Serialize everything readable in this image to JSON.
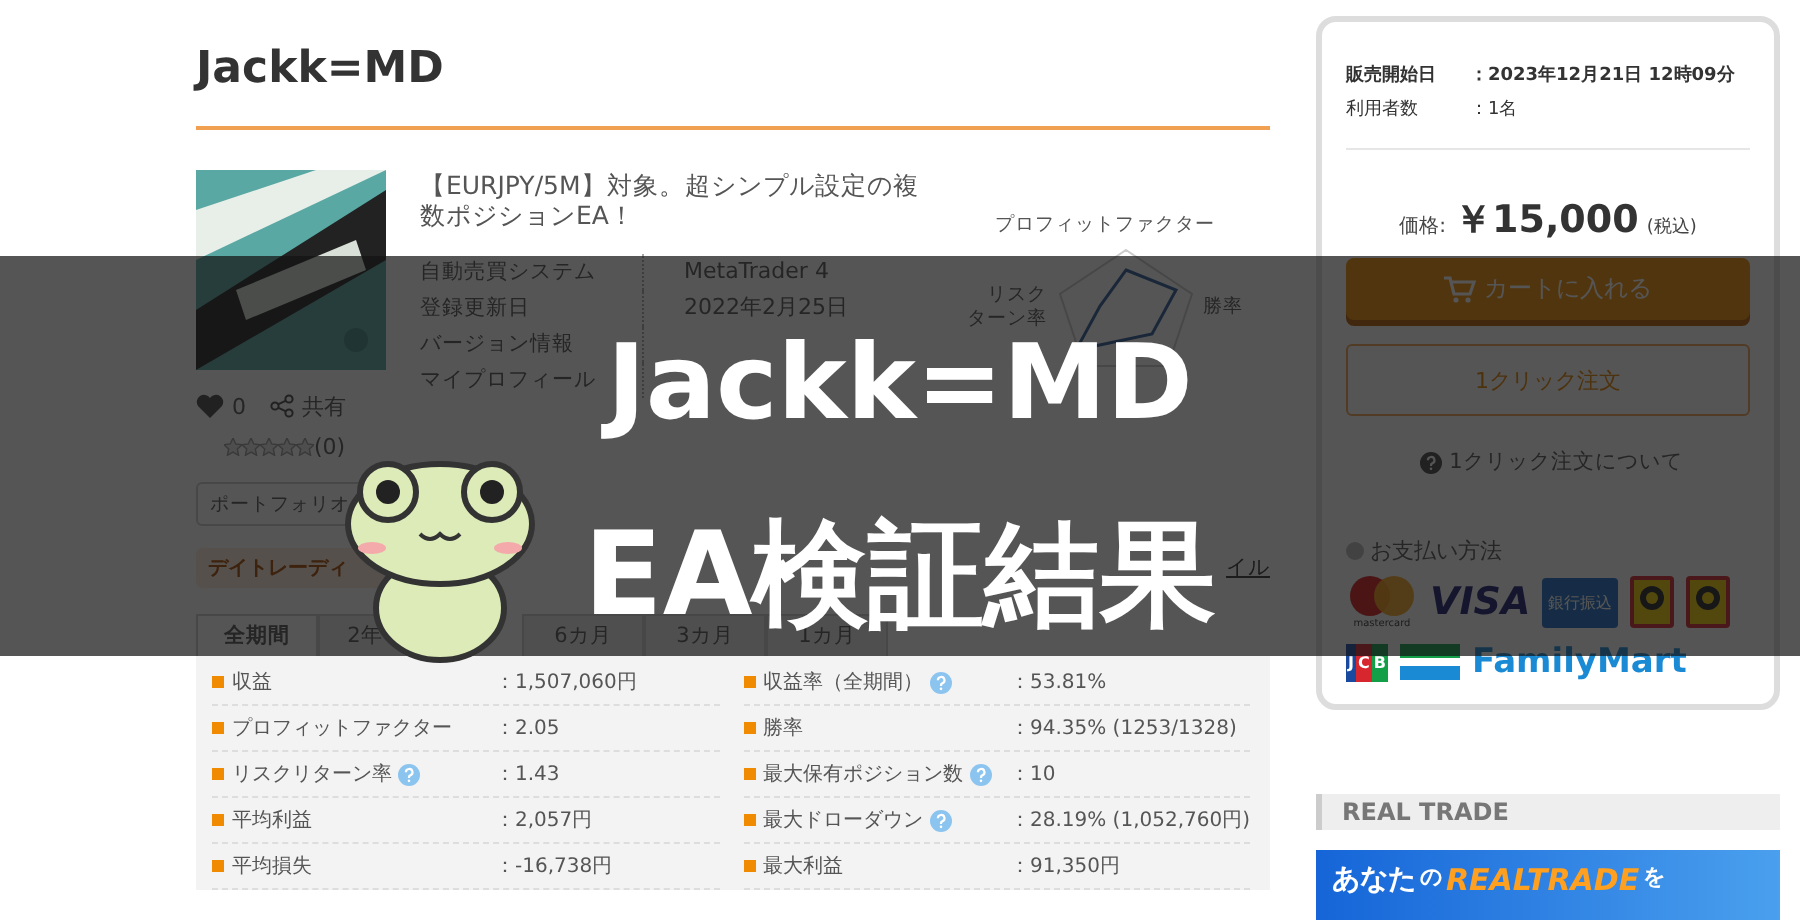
{
  "page_title": "Jackk=MD",
  "product": {
    "description": "【EURJPY/5M】対象。超シンプル設定の複数ポジションEA！",
    "info": [
      {
        "label": "自動売買システム",
        "value": "MetaTrader 4"
      },
      {
        "label": "登録更新日",
        "value": "2022年2月25日"
      },
      {
        "label": "バージョン情報"
      },
      {
        "label": "マイプロフィール"
      }
    ],
    "radar_labels": [
      "プロフィットファクター",
      "リスク",
      "ターン率",
      "勝率"
    ],
    "likes": "0",
    "share": "共有",
    "stars": 0,
    "review_count": "(0)",
    "portfolio_button": "ポートフォリオ",
    "tag": "デイトレーディ",
    "style_link": "イル"
  },
  "tabs": [
    {
      "label": "全期間",
      "selected": true
    },
    {
      "label": "2年",
      "selected": false
    },
    {
      "label": "6カ月",
      "selected": false
    },
    {
      "label": "3カ月",
      "selected": false
    },
    {
      "label": "1カ月",
      "selected": false
    }
  ],
  "stats": [
    {
      "label": "収益",
      "value": "：1,507,060円",
      "help": false
    },
    {
      "label": "収益率（全期間）",
      "value": "：53.81%",
      "help": true
    },
    {
      "label": "プロフィットファクター",
      "value": "：2.05",
      "help": false
    },
    {
      "label": "勝率",
      "value": "：94.35% (1253/1328)",
      "help": false
    },
    {
      "label": "リスクリターン率",
      "value": "：1.43",
      "help": true
    },
    {
      "label": "最大保有ポジション数",
      "value": "：10",
      "help": true
    },
    {
      "label": "平均利益",
      "value": "：2,057円",
      "help": false
    },
    {
      "label": "最大ドローダウン",
      "value": "：28.19% (1,052,760円)",
      "help": true
    },
    {
      "label": "平均損失",
      "value": "：-16,738円",
      "help": false
    },
    {
      "label": "最大利益",
      "value": "：91,350円",
      "help": false
    }
  ],
  "purchase": {
    "info": [
      {
        "label": "販売開始日",
        "value": "：2023年12月21日 12時09分",
        "bold": true
      },
      {
        "label": "利用者数",
        "value": "：1名",
        "bold": false
      }
    ],
    "price_label": "価格:",
    "price": "￥15,000",
    "tax": "(税込)",
    "cart_button": "カートに入れる",
    "one_click_button": "1クリック注文",
    "one_click_help": "1クリック注文について",
    "payment_title": "お支払い方法",
    "payment_methods": [
      {
        "kind": "mastercard",
        "label": "mastercard"
      },
      {
        "kind": "visa",
        "label": "VISA"
      },
      {
        "kind": "bank",
        "label": "銀行振込"
      },
      {
        "kind": "payeasy"
      },
      {
        "kind": "daily"
      },
      {
        "kind": "jcb",
        "label": "JCB"
      },
      {
        "kind": "familymart",
        "label": "FamilyMart"
      }
    ]
  },
  "sidebar_section": {
    "title": "REAL TRADE",
    "banner": [
      {
        "text": "あなた",
        "kind": "plain"
      },
      {
        "text": "の",
        "kind": "small"
      },
      {
        "text": "REALTRADE",
        "kind": "logo"
      },
      {
        "text": "を",
        "kind": "small"
      }
    ]
  },
  "overlay": {
    "title": "Jackk=MD",
    "subtitle": "EA検証結果"
  }
}
